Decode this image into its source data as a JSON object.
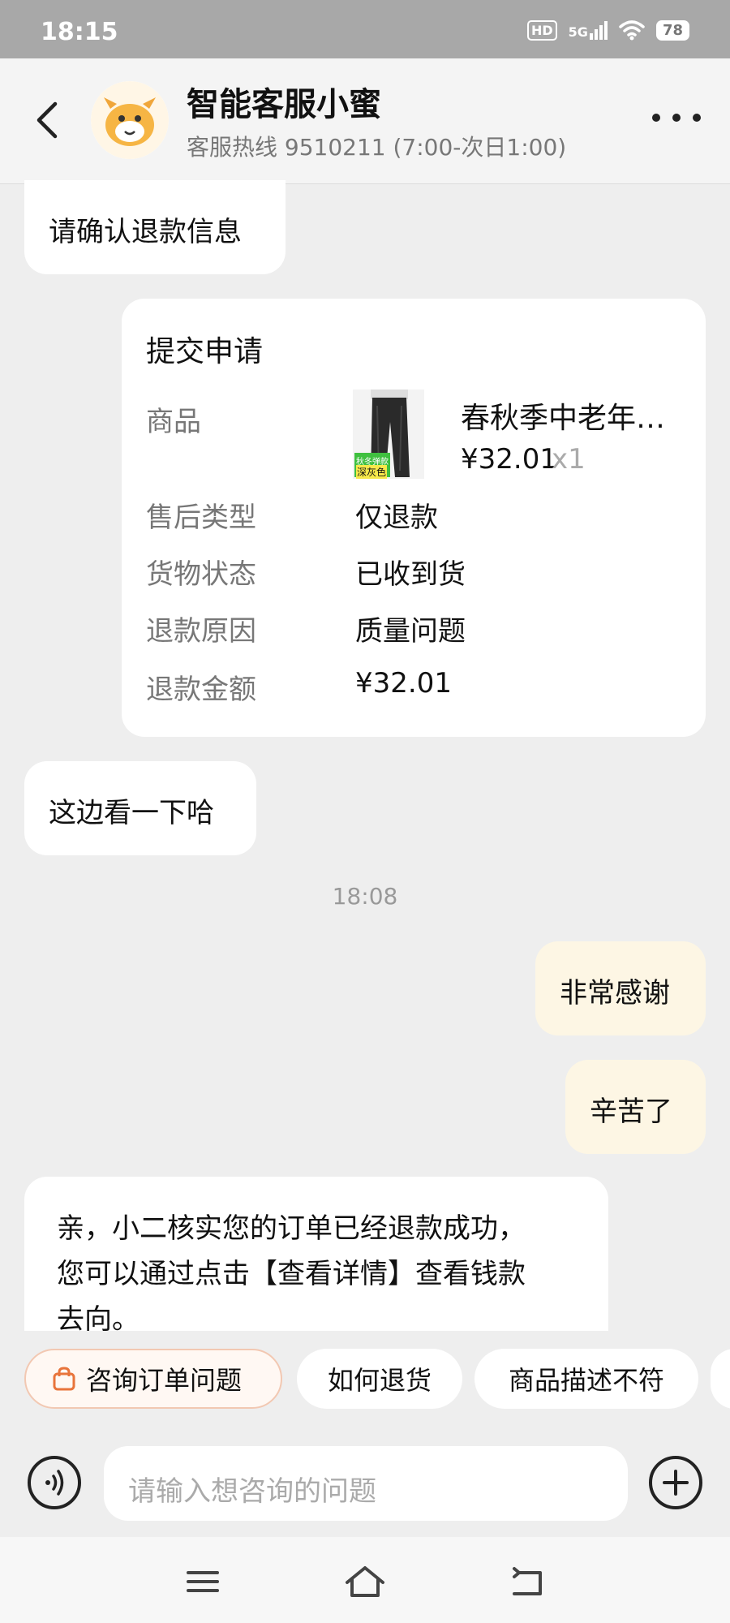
{
  "status_bar": {
    "time": "18:15",
    "hd": "HD",
    "network": "5G",
    "battery": "78"
  },
  "header": {
    "title": "智能客服小蜜",
    "subtitle": "客服热线 9510211 (7:00-次日1:00)"
  },
  "messages": {
    "confirm": "请确认退款信息",
    "look": "这边看一下哈",
    "timestamp": "18:08",
    "thanks": "非常感谢",
    "hard_work": "辛苦了",
    "refund_line1": "亲，小二核实您的订单已经退款成功，",
    "refund_line2": "您可以通过点击【查看详情】查看钱款",
    "refund_line3": "去向。"
  },
  "card": {
    "title": "提交申请",
    "product_label": "商品",
    "product_name": "春秋季中老年…",
    "product_price": "¥32.01",
    "product_qty": "x1",
    "product_tag_top": "秋冬弹款",
    "product_tag_bottom": "深灰色",
    "service_type_label": "售后类型",
    "service_type": "仅退款",
    "goods_status_label": "货物状态",
    "goods_status": "已收到货",
    "reason_label": "退款原因",
    "reason": "质量问题",
    "amount_label": "退款金额",
    "amount": "¥32.01"
  },
  "quick_chips": {
    "chip1": "咨询订单问题",
    "chip2": "如何退货",
    "chip3": "商品描述不符"
  },
  "input": {
    "placeholder": "请输入想咨询的问题"
  },
  "icons": {
    "back": "back-arrow-icon",
    "more": "more-dots-icon",
    "bag": "shopping-bag-icon",
    "voice": "voice-icon",
    "plus": "plus-icon",
    "menu": "menu-icon",
    "home": "home-icon",
    "return": "return-icon"
  },
  "colors": {
    "background": "#eeeeee",
    "my_bubble": "#fdf6e4",
    "chip_highlight_border": "#f2c8b2",
    "bag_icon": "#e8743b"
  }
}
